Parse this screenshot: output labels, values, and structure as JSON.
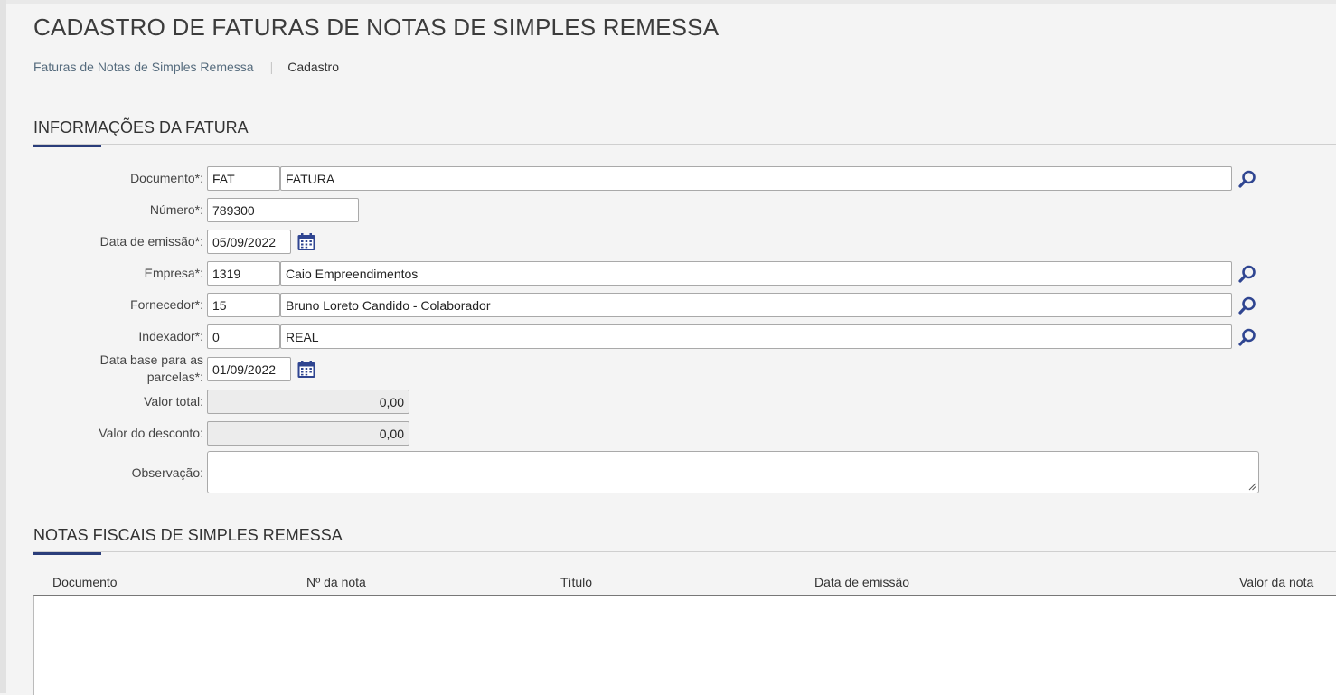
{
  "page": {
    "title": "CADASTRO DE FATURAS DE NOTAS DE SIMPLES REMESSA"
  },
  "breadcrumb": {
    "parent": "Faturas de Notas de Simples Remessa",
    "current": "Cadastro"
  },
  "invoice_section": {
    "title": "INFORMAÇÕES DA FATURA",
    "fields": {
      "documento": {
        "label": "Documento*:",
        "code": "FAT",
        "description": "FATURA"
      },
      "numero": {
        "label": "Número*:",
        "value": "789300"
      },
      "data_emissao": {
        "label": "Data de emissão*:",
        "value": "05/09/2022"
      },
      "empresa": {
        "label": "Empresa*:",
        "code": "1319",
        "description": "Caio Empreendimentos"
      },
      "fornecedor": {
        "label": "Fornecedor*:",
        "code": "15",
        "description": "Bruno Loreto Candido - Colaborador"
      },
      "indexador": {
        "label": "Indexador*:",
        "code": "0",
        "description": "REAL"
      },
      "data_base_parcelas": {
        "label": "Data base para as parcelas*:",
        "value": "01/09/2022"
      },
      "valor_total": {
        "label": "Valor total:",
        "value": "0,00"
      },
      "valor_desconto": {
        "label": "Valor do desconto:",
        "value": "0,00"
      },
      "observacao": {
        "label": "Observação:",
        "value": ""
      }
    }
  },
  "notes_section": {
    "title": "NOTAS FISCAIS DE SIMPLES REMESSA",
    "columns": [
      "Documento",
      "Nº da nota",
      "Título",
      "Data de emissão",
      "Valor da nota"
    ],
    "rows": []
  },
  "icons": {
    "search": "search-icon",
    "calendar": "calendar-icon"
  },
  "colors": {
    "accent": "#2a3d7a",
    "icon": "#2f4591",
    "background": "#f4f4f4"
  }
}
